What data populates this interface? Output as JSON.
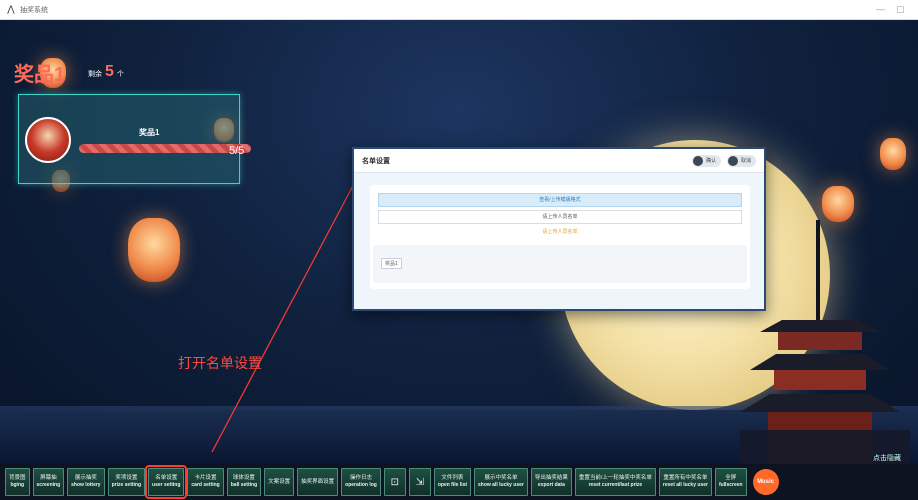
{
  "window": {
    "title": "抽奖系统"
  },
  "header": {
    "prize_title": "奖品1",
    "remain_label": "剩余",
    "remain_count": "5",
    "remain_unit": "个"
  },
  "prize_card": {
    "name": "奖品1",
    "ratio": "5/5",
    "progress": 1.0
  },
  "modal": {
    "title": "名单设置",
    "confirm_label": "确认",
    "cancel_label": "取消",
    "upload_label": "查看/上传模版格式",
    "name_input_placeholder": "请上传人员名单",
    "hint": "请上传人员名单",
    "list_items": [
      "奖品1"
    ]
  },
  "annotation": {
    "text": "打开名单设置"
  },
  "corner_text": "点击隐藏",
  "toolbar": {
    "items": [
      {
        "cn": "背景图",
        "en": "bging"
      },
      {
        "cn": "屏幕抽",
        "en": "screening"
      },
      {
        "cn": "展示抽奖",
        "en": "show lottery"
      },
      {
        "cn": "奖项设置",
        "en": "prize setting"
      },
      {
        "cn": "名单设置",
        "en": "user setting"
      },
      {
        "cn": "卡片设置",
        "en": "card setting"
      },
      {
        "cn": "球体设置",
        "en": "ball setting"
      },
      {
        "cn": "文案设置",
        "en": ""
      },
      {
        "cn": "抽奖界面设置",
        "en": ""
      },
      {
        "cn": "操作日志",
        "en": "operation log"
      },
      {
        "cn": "文件列表",
        "en": "open file list"
      },
      {
        "cn": "展示中奖名单",
        "en": "show all lucky user"
      },
      {
        "cn": "导出抽奖结果",
        "en": "export data"
      },
      {
        "cn": "重置当前/上一轮抽奖中奖名单",
        "en": "reset current/last prize"
      },
      {
        "cn": "重置所有中奖名单",
        "en": "reset all lucky user"
      },
      {
        "cn": "全屏",
        "en": "fullscreen"
      }
    ],
    "music_label": "Music"
  },
  "colors": {
    "accent": "#ff6b5b",
    "teal": "#3fd3c8",
    "toolbar_green": "#1f5042"
  }
}
